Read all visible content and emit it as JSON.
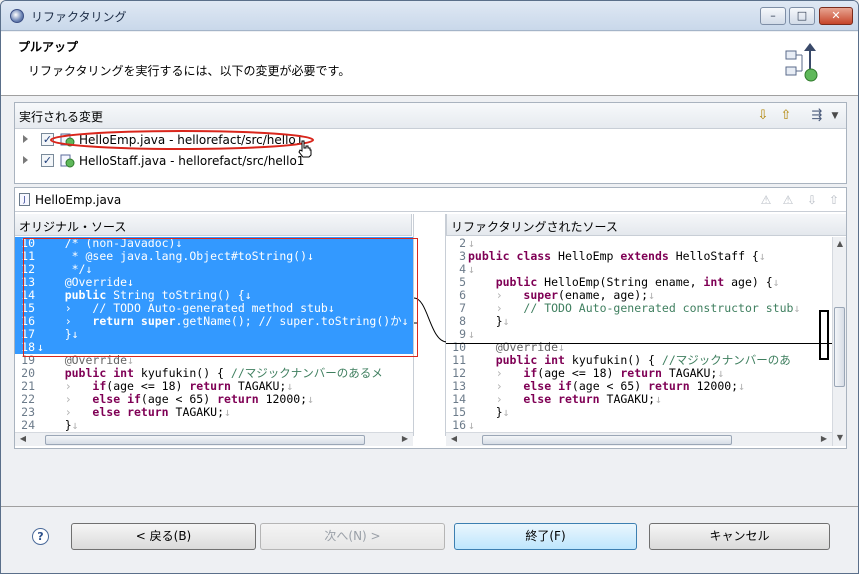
{
  "window": {
    "title": "リファクタリング",
    "min_label": "–",
    "max_label": "□",
    "close_label": "✕"
  },
  "header": {
    "title": "プルアップ",
    "description": "リファクタリングを実行するには、以下の変更が必要です。"
  },
  "changes": {
    "title": "実行される変更",
    "items": [
      {
        "label": "HelloEmp.java - hellorefact/src/hello1",
        "checked": true,
        "highlighted": true
      },
      {
        "label": "HelloStaff.java - hellorefact/src/hello1",
        "checked": true,
        "highlighted": false
      }
    ]
  },
  "compare": {
    "file": "HelloEmp.java",
    "left_title": "オリジナル・ソース",
    "right_title": "リファクタリングされたソース",
    "left_lines": [
      {
        "n": "10",
        "html": "    <span class='cm'>/* (non-Javadoc)</span><span class='cr'>↓</span>",
        "sel": true
      },
      {
        "n": "11",
        "html": "     <span class='cm'>* @see java.lang.Object#toString()</span><span class='cr'>↓</span>",
        "sel": true
      },
      {
        "n": "12",
        "html": "     <span class='cm'>*/</span><span class='cr'>↓</span>",
        "sel": true
      },
      {
        "n": "13",
        "html": "    <span class='an'>@Override</span><span class='cr'>↓</span>",
        "sel": true
      },
      {
        "n": "14",
        "html": "    <span class='kw'>public</span> String toString() {<span class='cr'>↓</span>",
        "sel": true
      },
      {
        "n": "15",
        "html": "    <span class='cr'>›</span>   <span class='cm'>// TODO Auto-generated method stub</span><span class='cr'>↓</span>",
        "sel": true
      },
      {
        "n": "16",
        "html": "    <span class='cr'>›</span>   <span class='kw'>return</span> <span class='kw'>super</span>.getName(); <span class='cm'>// super.toString()か↓</span>",
        "sel": true
      },
      {
        "n": "17",
        "html": "    }<span class='cr'>↓</span>",
        "sel": true
      },
      {
        "n": "18",
        "html": "<span class='cr'>↓</span>",
        "sel": true
      },
      {
        "n": "19",
        "html": "    <span class='an'>@Override</span><span class='cr'>↓</span>",
        "sel": false
      },
      {
        "n": "20",
        "html": "    <span class='kw'>public</span> <span class='kw'>int</span> kyufukin() { <span class='cm'>//マジックナンバーのあるメ</span>",
        "sel": false
      },
      {
        "n": "21",
        "html": "    <span class='cr'>›</span>   <span class='kw'>if</span>(age &lt;= 18) <span class='kw'>return</span> TAGAKU;<span class='cr'>↓</span>",
        "sel": false
      },
      {
        "n": "22",
        "html": "    <span class='cr'>›</span>   <span class='kw'>else</span> <span class='kw'>if</span>(age &lt; 65) <span class='kw'>return</span> 12000;<span class='cr'>↓</span>",
        "sel": false
      },
      {
        "n": "23",
        "html": "    <span class='cr'>›</span>   <span class='kw'>else</span> <span class='kw'>return</span> TAGAKU;<span class='cr'>↓</span>",
        "sel": false
      },
      {
        "n": "24",
        "html": "    }<span class='cr'>↓</span>",
        "sel": false
      }
    ],
    "right_lines": [
      {
        "n": "2",
        "html": "<span class='cr'>↓</span>"
      },
      {
        "n": "3",
        "html": "<span class='kw'>public</span> <span class='kw'>class</span> HelloEmp <span class='kw'>extends</span> HelloStaff {<span class='cr'>↓</span>"
      },
      {
        "n": "4",
        "html": "<span class='cr'>↓</span>"
      },
      {
        "n": "5",
        "html": "    <span class='kw'>public</span> HelloEmp(String ename, <span class='kw'>int</span> age) {<span class='cr'>↓</span>"
      },
      {
        "n": "6",
        "html": "    <span class='cr'>›</span>   <span class='kw'>super</span>(ename, age);<span class='cr'>↓</span>"
      },
      {
        "n": "7",
        "html": "    <span class='cr'>›</span>   <span class='cm'>// TODO Auto-generated constructor stub</span><span class='cr'>↓</span>"
      },
      {
        "n": "8",
        "html": "    }<span class='cr'>↓</span>"
      },
      {
        "n": "9",
        "html": "<span class='cr'>↓</span>"
      },
      {
        "n": "10",
        "html": "    <span class='an'>@Override</span><span class='cr'>↓</span>"
      },
      {
        "n": "11",
        "html": "    <span class='kw'>public</span> <span class='kw'>int</span> kyufukin() { <span class='cm'>//マジックナンバーのあ</span>"
      },
      {
        "n": "12",
        "html": "    <span class='cr'>›</span>   <span class='kw'>if</span>(age &lt;= 18) <span class='kw'>return</span> TAGAKU;<span class='cr'>↓</span>"
      },
      {
        "n": "13",
        "html": "    <span class='cr'>›</span>   <span class='kw'>else</span> <span class='kw'>if</span>(age &lt; 65) <span class='kw'>return</span> 12000;<span class='cr'>↓</span>"
      },
      {
        "n": "14",
        "html": "    <span class='cr'>›</span>   <span class='kw'>else</span> <span class='kw'>return</span> TAGAKU;<span class='cr'>↓</span>"
      },
      {
        "n": "15",
        "html": "    }<span class='cr'>↓</span>"
      },
      {
        "n": "16",
        "html": "<span class='cr'>↓</span>"
      }
    ]
  },
  "buttons": {
    "help": "?",
    "back": "< 戻る(B)",
    "next": "次へ(N) >",
    "finish": "終了(F)",
    "cancel": "キャンセル"
  },
  "colors": {
    "selection": "#3399ff",
    "keyword": "#7f0055",
    "comment": "#3f7f5f",
    "highlight_outline": "#d9261c"
  }
}
